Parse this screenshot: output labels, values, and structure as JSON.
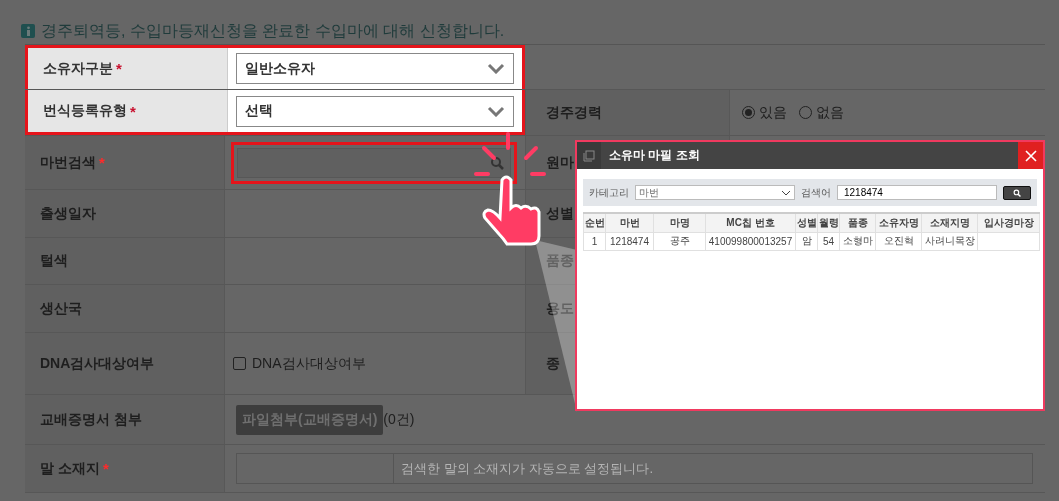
{
  "notice": "경주퇴역등, 수입마등재신청을 완료한 수입마에 대해 신청합니다.",
  "rows": [
    {
      "label": "소유자구분",
      "required": "*",
      "highlighted": true,
      "field": {
        "kind": "select",
        "value": "일반소유자"
      }
    },
    {
      "label": "번식등록유형",
      "required": "*",
      "highlighted": true,
      "field": {
        "kind": "select",
        "value": "선택"
      },
      "side": {
        "label": "경주경력",
        "options": [
          {
            "label": "있음",
            "selected": true
          },
          {
            "label": "없음",
            "selected": false
          }
        ]
      }
    },
    {
      "label": "마번검색",
      "required": "*",
      "highlighted": false,
      "field": {
        "kind": "search",
        "highlighted": true
      },
      "side": {
        "label": "원마"
      }
    },
    {
      "label": "출생일자",
      "highlighted": false,
      "field": {
        "kind": "empty"
      },
      "side": {
        "label": "성별"
      }
    },
    {
      "label": "털색",
      "highlighted": false,
      "field": {
        "kind": "empty"
      },
      "side": {
        "label": "품종"
      }
    },
    {
      "label": "생산국",
      "highlighted": false,
      "field": {
        "kind": "empty"
      },
      "side": {
        "label": "용도"
      }
    },
    {
      "label": "DNA검사대상여부",
      "highlighted": false,
      "field": {
        "kind": "checkbox",
        "label": "DNA검사대상여부",
        "checked": false
      },
      "side": {
        "label": "종"
      }
    },
    {
      "label": "교배증명서 첨부",
      "highlighted": false,
      "field": {
        "kind": "file",
        "button": "파일첨부(교배증명서)",
        "count": "(0건)"
      }
    },
    {
      "label": "말 소재지",
      "required": "*",
      "highlighted": false,
      "field": {
        "kind": "location",
        "placeholder": "검색한 말의 소재지가 자동으로 설정됩니다."
      }
    }
  ],
  "popup": {
    "title": "소유마 마필 조회",
    "search": {
      "category_label": "카테고리",
      "category": "마번",
      "keyword_label": "검색어",
      "keyword": "1218474"
    },
    "columns": [
      "순번",
      "마번",
      "마명",
      "MC칩 번호",
      "성별",
      "월령",
      "품종",
      "소유자명",
      "소재지명",
      "입사경마장"
    ],
    "rows": [
      [
        "1",
        "1218474",
        "공주",
        "410099800013257",
        "암",
        "54",
        "소형마",
        "오진혁",
        "사려니목장",
        ""
      ]
    ]
  }
}
